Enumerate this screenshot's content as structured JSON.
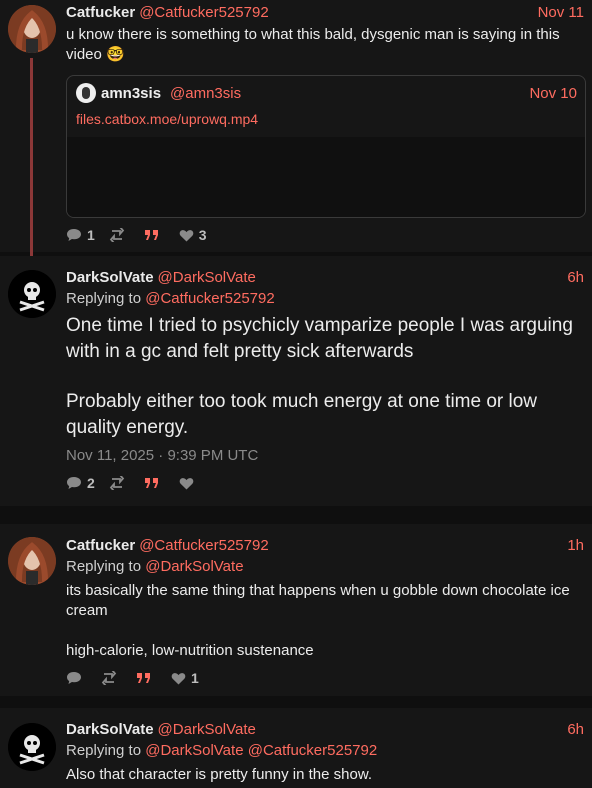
{
  "posts": [
    {
      "name": "Catfucker",
      "handle": "@Catfucker525792",
      "date": "Nov 11",
      "text": "u know there is something to what this bald, dysgenic man is saying in this video",
      "emoji": "🤓",
      "quote": {
        "name": "amn3sis",
        "handle": "@amn3sis",
        "date": "Nov 10",
        "link": "files.catbox.moe/uprowq.mp4"
      },
      "stats": {
        "replies": "1",
        "retweets": "",
        "quotes": "",
        "likes": "3"
      }
    },
    {
      "name": "DarkSolVate",
      "handle": "@DarkSolVate",
      "date": "6h",
      "reply_prefix": "Replying to",
      "reply_to": [
        "@Catfucker525792"
      ],
      "text1": "One time I tried to psychicly vamparize people I was arguing with in a gc and felt pretty sick afterwards",
      "text2": "Probably either too took much energy at one time or low quality energy.",
      "timestamp": "Nov 11, 2025 · 9:39 PM UTC",
      "stats": {
        "replies": "2",
        "retweets": "",
        "quotes": "",
        "likes": ""
      }
    },
    {
      "name": "Catfucker",
      "handle": "@Catfucker525792",
      "date": "1h",
      "reply_prefix": "Replying to",
      "reply_to": [
        "@DarkSolVate"
      ],
      "text1": "its basically the same thing that happens when u gobble down chocolate ice cream",
      "text2": "high-calorie, low-nutrition sustenance",
      "stats": {
        "replies": "",
        "retweets": "",
        "quotes": "",
        "likes": "1"
      }
    },
    {
      "name": "DarkSolVate",
      "handle": "@DarkSolVate",
      "date": "6h",
      "reply_prefix": "Replying to",
      "reply_to": [
        "@DarkSolVate",
        "@Catfucker525792"
      ],
      "text1": "Also that character is pretty funny in the show."
    }
  ],
  "icons": {
    "reply": "speech-bubble-icon",
    "retweet": "retweet-icon",
    "quote": "quote-marks-icon",
    "like": "heart-icon"
  },
  "colors": {
    "accent": "#ff6c60",
    "background": "#0f0f0f",
    "panel": "#161616",
    "thread_line": "#8c3838"
  }
}
